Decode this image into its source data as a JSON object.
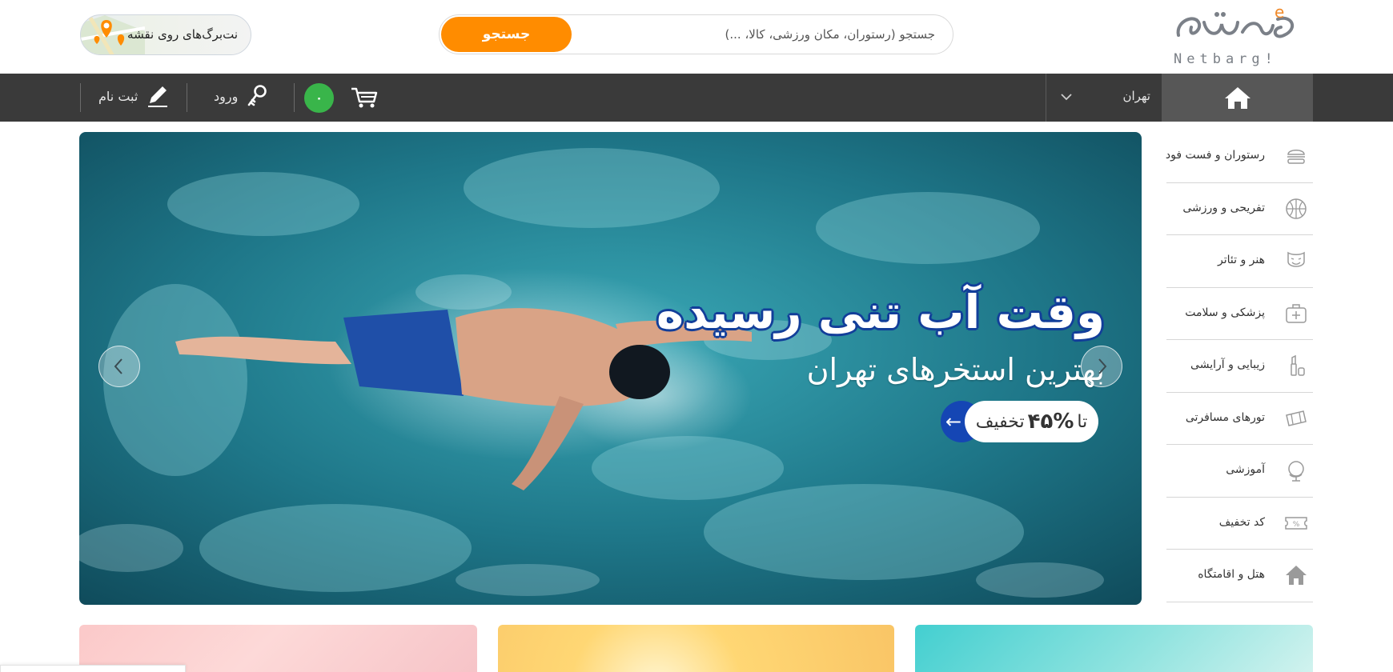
{
  "header": {
    "brand_text": "Netbarg!",
    "search": {
      "placeholder": "جستجو (رستوران، مکان ورزشی، کالا، ...)",
      "button_label": "جستجو"
    },
    "map_button_label": "نت‌برگ‌های روی نقشه"
  },
  "navbar": {
    "city": "تهران",
    "login_label": "ورود",
    "signup_label": "ثبت نام",
    "cart_count": "۰"
  },
  "slider": {
    "headline": "وقت آب تنی رسیده",
    "subline": "بهترین استخرهای تهران",
    "offer": {
      "prefix": "تا",
      "amount": "۴۵%",
      "suffix": "تخفیف"
    }
  },
  "categories": [
    {
      "label": "رستوران و فست فود",
      "icon": "burger-icon"
    },
    {
      "label": "تفریحی و ورزشی",
      "icon": "basketball-icon"
    },
    {
      "label": "هنر و تئاتر",
      "icon": "theater-mask-icon"
    },
    {
      "label": "پزشکی و سلامت",
      "icon": "medical-kit-icon"
    },
    {
      "label": "زیبایی و آرایشی",
      "icon": "cosmetics-icon"
    },
    {
      "label": "تورهای مسافرتی",
      "icon": "suitcase-icon"
    },
    {
      "label": "آموزشی",
      "icon": "globe-icon"
    },
    {
      "label": "کد تخفیف",
      "icon": "coupon-icon"
    },
    {
      "label": "هتل و اقامتگاه",
      "icon": "hotel-icon"
    }
  ],
  "colors": {
    "accent_orange": "#ff8c00",
    "navbar_bg": "#3a3a3a",
    "home_bg": "#575757",
    "cart_badge": "#39b54a",
    "offer_blue": "#1546b4"
  }
}
